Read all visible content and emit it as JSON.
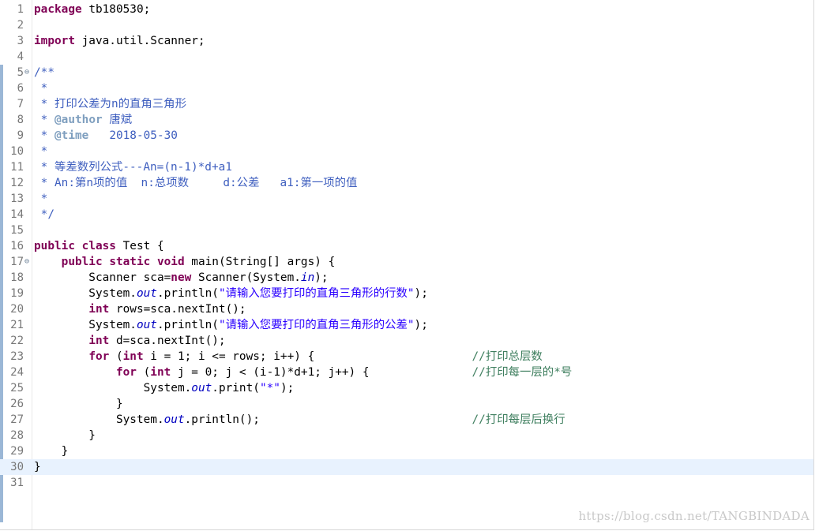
{
  "editor": {
    "language": "java",
    "current_line": 30,
    "colors": {
      "keyword": "#7f0055",
      "javadoc": "#3f5fbf",
      "javadoc_tag": "#7f9fbf",
      "string": "#2a00ff",
      "static_field": "#0000c0",
      "comment": "#3f7f5f",
      "line_number": "#787878",
      "current_line_bg": "#e8f2fe",
      "overview_ruler": "#9bb7d6"
    },
    "fold_icon": "collapse-minus-icon",
    "lines": [
      {
        "n": "1",
        "tokens": [
          {
            "t": "kw",
            "v": "package"
          },
          {
            "t": "plain",
            "v": " tb180530;"
          }
        ]
      },
      {
        "n": "2",
        "tokens": []
      },
      {
        "n": "3",
        "tokens": [
          {
            "t": "kw",
            "v": "import"
          },
          {
            "t": "plain",
            "v": " java.util.Scanner;"
          }
        ]
      },
      {
        "n": "4",
        "tokens": []
      },
      {
        "n": "5",
        "fold": "⊖",
        "tokens": [
          {
            "t": "jd",
            "v": "/**"
          }
        ]
      },
      {
        "n": "6",
        "tokens": [
          {
            "t": "jd",
            "v": " *"
          }
        ]
      },
      {
        "n": "7",
        "tokens": [
          {
            "t": "jd",
            "v": " * 打印公差为n的直角三角形"
          }
        ]
      },
      {
        "n": "8",
        "tokens": [
          {
            "t": "jd",
            "v": " * "
          },
          {
            "t": "tag",
            "v": "@author"
          },
          {
            "t": "jd",
            "v": " 唐斌"
          }
        ]
      },
      {
        "n": "9",
        "tokens": [
          {
            "t": "jd",
            "v": " * "
          },
          {
            "t": "tag",
            "v": "@time"
          },
          {
            "t": "jd",
            "v": "   2018-05-30"
          }
        ]
      },
      {
        "n": "10",
        "tokens": [
          {
            "t": "jd",
            "v": " *"
          }
        ]
      },
      {
        "n": "11",
        "tokens": [
          {
            "t": "jd",
            "v": " * 等差数列公式---An=(n-1)*d+a1"
          }
        ]
      },
      {
        "n": "12",
        "tokens": [
          {
            "t": "jd",
            "v": " * An:第n项的值  n:总项数     d:公差   a1:第一项的值"
          }
        ]
      },
      {
        "n": "13",
        "tokens": [
          {
            "t": "jd",
            "v": " *"
          }
        ]
      },
      {
        "n": "14",
        "tokens": [
          {
            "t": "jd",
            "v": " */"
          }
        ]
      },
      {
        "n": "15",
        "tokens": []
      },
      {
        "n": "16",
        "tokens": [
          {
            "t": "kw",
            "v": "public"
          },
          {
            "t": "plain",
            "v": " "
          },
          {
            "t": "kw",
            "v": "class"
          },
          {
            "t": "plain",
            "v": " Test {"
          }
        ]
      },
      {
        "n": "17",
        "fold": "⊖",
        "tokens": [
          {
            "t": "plain",
            "v": "    "
          },
          {
            "t": "kw",
            "v": "public"
          },
          {
            "t": "plain",
            "v": " "
          },
          {
            "t": "kw",
            "v": "static"
          },
          {
            "t": "plain",
            "v": " "
          },
          {
            "t": "kw",
            "v": "void"
          },
          {
            "t": "plain",
            "v": " main(String[] args) {"
          }
        ]
      },
      {
        "n": "18",
        "tokens": [
          {
            "t": "plain",
            "v": "        Scanner sca="
          },
          {
            "t": "kw",
            "v": "new"
          },
          {
            "t": "plain",
            "v": " Scanner(System."
          },
          {
            "t": "fld",
            "v": "in"
          },
          {
            "t": "plain",
            "v": ");"
          }
        ]
      },
      {
        "n": "19",
        "tokens": [
          {
            "t": "plain",
            "v": "        System."
          },
          {
            "t": "fld",
            "v": "out"
          },
          {
            "t": "plain",
            "v": ".println("
          },
          {
            "t": "str",
            "v": "\"请输入您要打印的直角三角形的行数\""
          },
          {
            "t": "plain",
            "v": ");"
          }
        ]
      },
      {
        "n": "20",
        "tokens": [
          {
            "t": "plain",
            "v": "        "
          },
          {
            "t": "kw",
            "v": "int"
          },
          {
            "t": "plain",
            "v": " rows=sca.nextInt();"
          }
        ]
      },
      {
        "n": "21",
        "tokens": [
          {
            "t": "plain",
            "v": "        System."
          },
          {
            "t": "fld",
            "v": "out"
          },
          {
            "t": "plain",
            "v": ".println("
          },
          {
            "t": "str",
            "v": "\"请输入您要打印的直角三角形的公差\""
          },
          {
            "t": "plain",
            "v": ");"
          }
        ]
      },
      {
        "n": "22",
        "tokens": [
          {
            "t": "plain",
            "v": "        "
          },
          {
            "t": "kw",
            "v": "int"
          },
          {
            "t": "plain",
            "v": " d=sca.nextInt();"
          }
        ]
      },
      {
        "n": "23",
        "tokens": [
          {
            "t": "plain",
            "v": "        "
          },
          {
            "t": "kw",
            "v": "for"
          },
          {
            "t": "plain",
            "v": " ("
          },
          {
            "t": "kw",
            "v": "int"
          },
          {
            "t": "plain",
            "v": " i = 1; i <= rows; i++) {                       "
          },
          {
            "t": "cm",
            "v": "//打印总层数"
          }
        ]
      },
      {
        "n": "24",
        "tokens": [
          {
            "t": "plain",
            "v": "            "
          },
          {
            "t": "kw",
            "v": "for"
          },
          {
            "t": "plain",
            "v": " ("
          },
          {
            "t": "kw",
            "v": "int"
          },
          {
            "t": "plain",
            "v": " j = 0; j < (i-1)*d+1; j++) {               "
          },
          {
            "t": "cm",
            "v": "//打印每一层的*号"
          }
        ]
      },
      {
        "n": "25",
        "tokens": [
          {
            "t": "plain",
            "v": "                System."
          },
          {
            "t": "fld",
            "v": "out"
          },
          {
            "t": "plain",
            "v": ".print("
          },
          {
            "t": "str",
            "v": "\"*\""
          },
          {
            "t": "plain",
            "v": ");"
          }
        ]
      },
      {
        "n": "26",
        "tokens": [
          {
            "t": "plain",
            "v": "            }"
          }
        ]
      },
      {
        "n": "27",
        "tokens": [
          {
            "t": "plain",
            "v": "            System."
          },
          {
            "t": "fld",
            "v": "out"
          },
          {
            "t": "plain",
            "v": ".println();                               "
          },
          {
            "t": "cm",
            "v": "//打印每层后换行"
          }
        ]
      },
      {
        "n": "28",
        "tokens": [
          {
            "t": "plain",
            "v": "        }"
          }
        ]
      },
      {
        "n": "29",
        "tokens": [
          {
            "t": "plain",
            "v": "    }"
          }
        ]
      },
      {
        "n": "30",
        "tokens": [
          {
            "t": "plain",
            "v": "}"
          }
        ]
      },
      {
        "n": "31",
        "tokens": []
      }
    ]
  },
  "watermark": "https://blog.csdn.net/TANGBINDADA"
}
